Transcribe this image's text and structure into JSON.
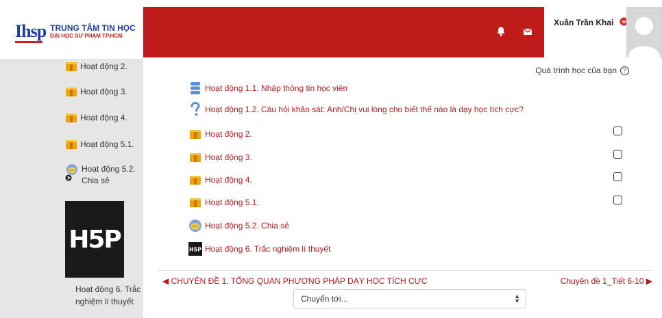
{
  "header": {
    "logo_mark": "Ihsp",
    "logo_line1": "TRUNG TÂM TIN HỌC",
    "logo_line2": "ĐẠI HỌC SƯ PHẠM TP.HCM",
    "username": "Xuân Trần Khai",
    "brand_color": "#c01b1b"
  },
  "sidebar": {
    "items": [
      {
        "label": "Hoạt động 2.",
        "icon": "package-icon"
      },
      {
        "label": "Hoạt động 3.",
        "icon": "package-icon"
      },
      {
        "label": "Hoạt động 4.",
        "icon": "package-icon"
      },
      {
        "label": "Hoạt động 5.1.",
        "icon": "package-icon"
      },
      {
        "label_line1": "Hoạt động 5.2.",
        "label_line2": "Chia sẻ",
        "icon": "chat-icon"
      }
    ],
    "h5p_logo": "H5P",
    "h5p_label_line1": "Hoạt động 6. Trắc",
    "h5p_label_line2": "nghiệm lí thuyết"
  },
  "main": {
    "progress_label": "Quá trình học của bạn",
    "activities": [
      {
        "label": "Hoạt động 1.1. Nhập thông tin học viên",
        "icon": "database-icon",
        "checkbox": false
      },
      {
        "label": "Hoạt động 1.2. Câu hỏi khảo sát: Anh/Chị vui lòng cho biết thế nào là dạy học tích cực?",
        "icon": "question-icon",
        "checkbox": false
      },
      {
        "label": "Hoạt động 2.",
        "icon": "package-icon",
        "checkbox": true
      },
      {
        "label": "Hoạt động 3.",
        "icon": "package-icon",
        "checkbox": true
      },
      {
        "label": "Hoạt động 4.",
        "icon": "package-icon",
        "checkbox": true
      },
      {
        "label": "Hoạt động 5.1.",
        "icon": "package-icon",
        "checkbox": true
      },
      {
        "label": "Hoạt động 5.2. Chia sẻ",
        "icon": "chat-icon",
        "checkbox": false
      },
      {
        "label": "Hoạt động 6. Trắc nghiệm lí thuyết",
        "icon": "h5p-icon",
        "checkbox": false
      }
    ],
    "prev_link": "◀ CHUYÊN ĐỀ 1. TỔNG QUAN PHƯƠNG PHÁP DẠY HỌC TÍCH CỰC",
    "next_link": "Chuyên đề 1_Tiết 6-10 ▶",
    "jump_placeholder": "Chuyển tới...",
    "link_color": "#b5191e"
  }
}
